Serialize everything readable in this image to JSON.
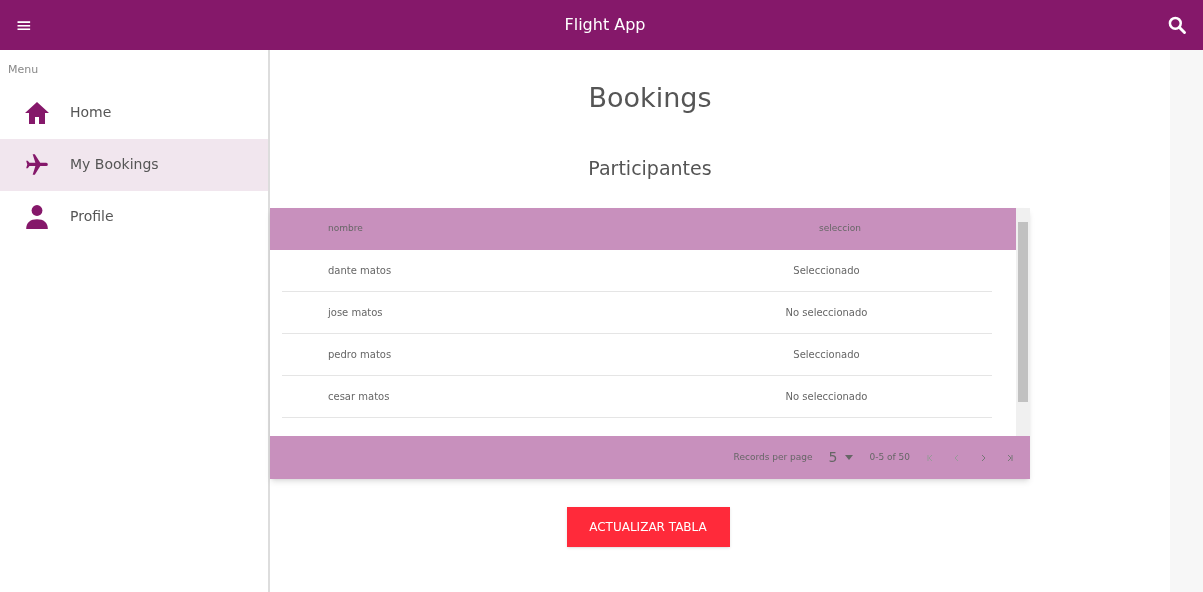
{
  "app_bar": {
    "menu_icon": "≡",
    "title": "Flight App"
  },
  "sidebar": {
    "heading": "Menu",
    "items": [
      {
        "label": "Home",
        "kind": "home",
        "selected": false
      },
      {
        "label": "My Bookings",
        "kind": "travel",
        "selected": true
      },
      {
        "label": "Profile",
        "kind": "account",
        "selected": false
      }
    ]
  },
  "page_title": "Bookings",
  "section_title": "Participantes",
  "table": {
    "columns": [
      "nombre",
      "seleccion"
    ],
    "rows": [
      [
        "dante matos",
        "Seleccionado"
      ],
      [
        "jose matos",
        "No seleccionado"
      ],
      [
        "pedro matos",
        "Seleccionado"
      ],
      [
        "cesar matos",
        "No seleccionado"
      ]
    ],
    "pagination": {
      "label": "Records per page",
      "page_size": "5",
      "range": "0-5 of 50"
    }
  },
  "button": "ACTUALIZAR TABLA"
}
